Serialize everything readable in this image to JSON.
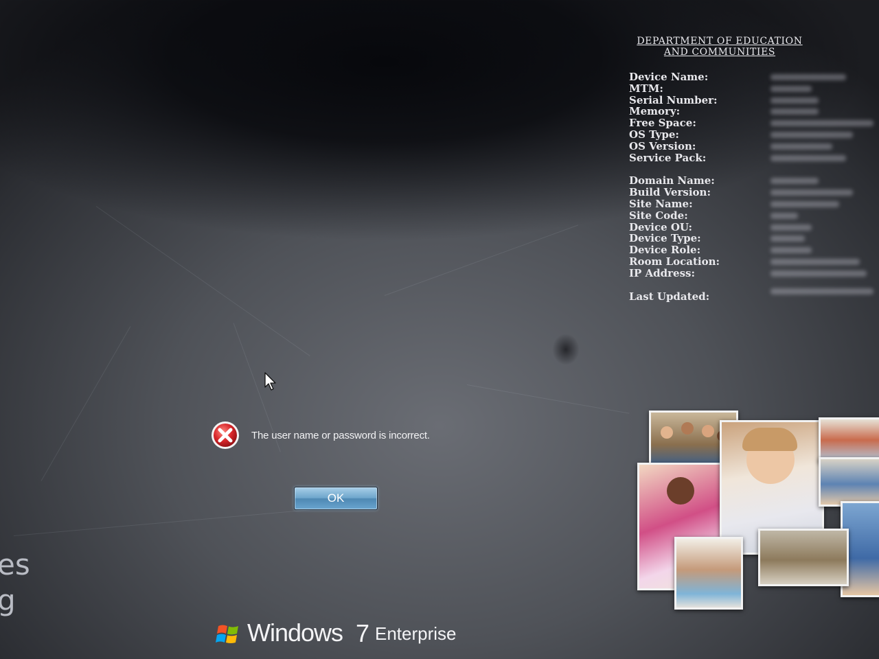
{
  "info_panel": {
    "department_line1": "DEPARTMENT OF EDUCATION",
    "department_line2": "AND COMMUNITIES",
    "fields": [
      {
        "label": "Device Name:"
      },
      {
        "label": "MTM:"
      },
      {
        "label": "Serial Number:"
      },
      {
        "label": "Memory:"
      },
      {
        "label": "Free Space:"
      },
      {
        "label": "OS Type:"
      },
      {
        "label": "OS Version:"
      },
      {
        "label": "Service Pack:"
      },
      {
        "label": "Domain Name:"
      },
      {
        "label": "Build Version:"
      },
      {
        "label": "Site Name:"
      },
      {
        "label": "Site Code:"
      },
      {
        "label": "Device OU:"
      },
      {
        "label": "Device Type:"
      },
      {
        "label": "Device Role:"
      },
      {
        "label": "Room Location:"
      },
      {
        "label": "IP Address:"
      },
      {
        "label": "Last Updated:"
      }
    ]
  },
  "dialog": {
    "message": "The user name or password is incorrect.",
    "ok_label": "OK",
    "icon": "error-icon"
  },
  "left_fragments": {
    "line1": "es",
    "line2": "g"
  },
  "branding": {
    "windows_word": "Windows",
    "version": "7",
    "edition": "Enterprise"
  },
  "colors": {
    "error_red": "#d8262a",
    "button_blue": "#6ea6cc"
  }
}
